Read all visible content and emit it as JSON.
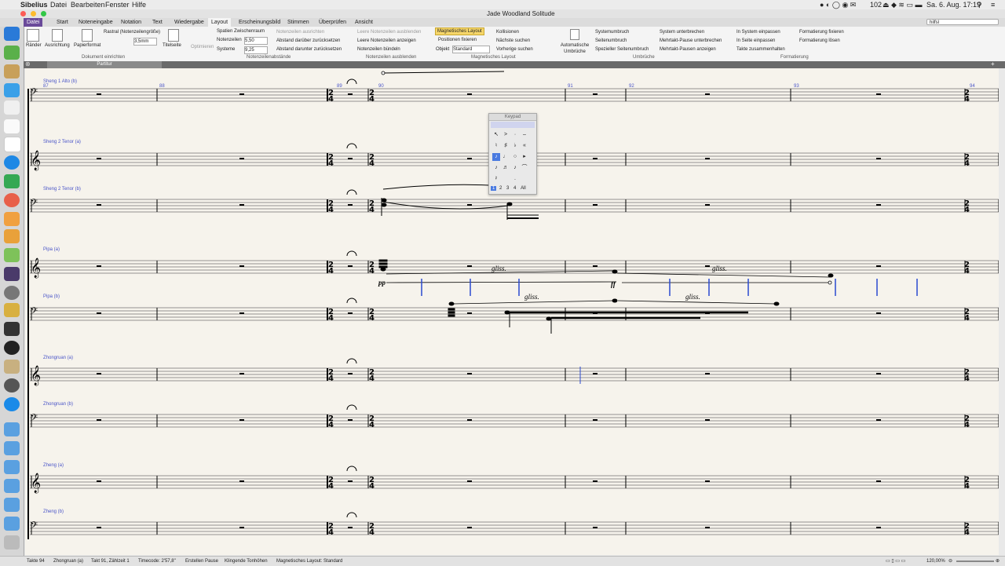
{
  "menubar": {
    "app": "Sibelius",
    "items": [
      "Datei",
      "Bearbeiten",
      "Fenster",
      "Hilfe"
    ],
    "mail_count": "102",
    "clock": "Sa. 6. Aug. 17:19"
  },
  "window": {
    "title": "Jade Woodland Solitude"
  },
  "tabs": [
    "Datei",
    "Start",
    "Noteneingabe",
    "Notation",
    "Text",
    "Wiedergabe",
    "Layout",
    "Erscheinungsbild",
    "Stimmen",
    "Überprüfen",
    "Ansicht"
  ],
  "active_tab": "Layout",
  "search": {
    "value": "hilfsl"
  },
  "ribbon": {
    "doc_setup": {
      "raender": "Ränder",
      "ausrichtung": "Ausrichtung",
      "papierformat": "Papierformat",
      "rastral": "Rastral (Notenzeilengröße)",
      "rastral_value": "3,5mm",
      "titelseite": "Titelseite",
      "group": "Dokument einrichten"
    },
    "staff_spacing": {
      "optimieren": "Optimieren",
      "spatien": "Spatien Zwischenraum",
      "notenzeilen": "Notenzeilen",
      "notenzeilen_value": "5,50",
      "systeme": "Systeme",
      "systeme_value": "9,25",
      "group": "Notenzeilenabstände",
      "ausrichten": "Notenzeilen ausrichten",
      "abstand_darueber": "Abstand darüber zurücksetzen",
      "abstand_darunter": "Abstand darunter zurücksetzen"
    },
    "hide_staves": {
      "leere_ausblenden": "Leere Notenzeilen ausblenden",
      "leere_anzeigen": "Leere Notenzeilen anzeigen",
      "buendeln": "Notenzeilen bündeln",
      "group": "Notenzeilen ausblenden"
    },
    "magnetic": {
      "magnetisches": "Magnetisches Layout",
      "positionen": "Positionen fixieren",
      "objekt": "Objekt",
      "objekt_value": "Standard",
      "kollisionen": "Kollisionen",
      "naechste": "Nächste suchen",
      "vorherige": "Vorherige suchen",
      "group": "Magnetisches Layout"
    },
    "breaks": {
      "automatische": "Automatische Umbrüche",
      "systemumbruch": "Systemumbruch",
      "seitenumbruch": "Seitenumbruch",
      "spezieller": "Spezieller Seitenumbruch",
      "system_unterbrechen": "System unterbrechen",
      "mehrtakt_unterbrechen": "Mehrtakt-Pause unterbrechen",
      "mehrtakt_anzeigen": "Mehrtakt-Pausen anzeigen",
      "group": "Umbrüche"
    },
    "formatting": {
      "in_system": "In System einpassen",
      "in_seite": "In Seite einpassen",
      "takte_zusammen": "Takte zusammenhalten",
      "fixieren": "Formatierung fixieren",
      "loesen": "Formatierung lösen",
      "group": "Formatierung"
    }
  },
  "partbar": {
    "label": "Partitur"
  },
  "score": {
    "instruments": [
      "Sheng 1 Alto (b)",
      "Sheng 2 Tenor (a)",
      "Sheng 2 Tenor (b)",
      "Pipa   (a)",
      "Pipa   (b)",
      "Zhongruan (a)",
      "Zhongruan (b)",
      "Zheng (a)",
      "Zheng (b)"
    ],
    "bar_numbers": [
      "87",
      "88",
      "89",
      "90",
      "91",
      "92",
      "93",
      "94"
    ],
    "glissando": "gliss.",
    "dynamics": {
      "pp": "pp",
      "ff": "ff"
    }
  },
  "keypad": {
    "title": "Keypad",
    "layouts": [
      "1",
      "2",
      "3",
      "4",
      "All"
    ]
  },
  "status": {
    "takte": "Takte 94",
    "stimme": "Zhongruan (a)",
    "position": "Takt 91, Zählzeit 1",
    "timecode": "Timecode: 2'57,8\"",
    "pause": "Erstellen Pause",
    "tonhoehen": "Klingende Tonhöhen",
    "layout": "Magnetisches Layout: Standard",
    "zoom": "120,00%"
  }
}
